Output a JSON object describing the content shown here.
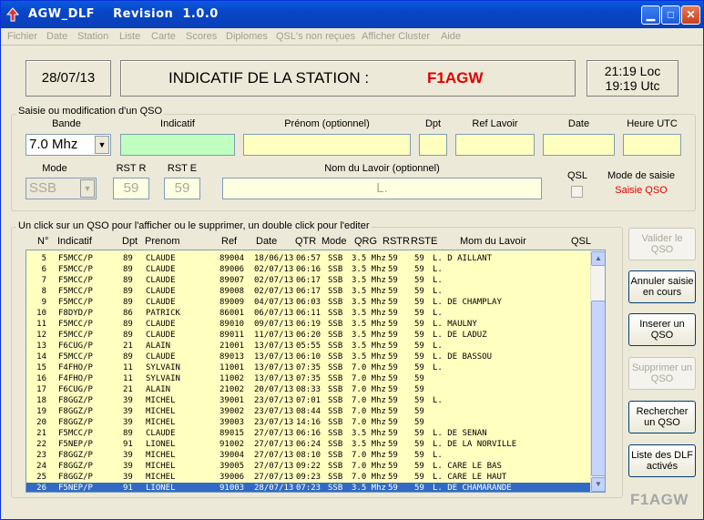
{
  "window": {
    "title": "AGW_DLF    Revision  1.0.0",
    "controls": [
      "minimize",
      "maximize",
      "close"
    ]
  },
  "menu": [
    "Fichier",
    "Date",
    "Station",
    "Liste",
    "Carte",
    "Scores",
    "Diplomes",
    "QSL's non reçues",
    "Afficher Cluster",
    "Aide"
  ],
  "header": {
    "date": "28/07/13",
    "station_label": "INDICATIF DE LA STATION  :",
    "callsign": "F1AGW",
    "time_loc": "21:19 Loc",
    "time_utc": "19:19 Utc"
  },
  "form": {
    "group_label": "Saisie ou modification d'un QSO",
    "labels": {
      "bande": "Bande",
      "indicatif": "Indicatif",
      "prenom": "Prénom (optionnel)",
      "dpt": "Dpt",
      "ref": "Ref Lavoir",
      "date": "Date",
      "heure": "Heure UTC",
      "mode": "Mode",
      "rstr": "RST R",
      "rste": "RST E",
      "lavoir": "Nom du Lavoir (optionnel)",
      "qsl": "QSL",
      "mode_saisie": "Mode de saisie"
    },
    "values": {
      "bande": "7.0 Mhz",
      "mode": "SSB",
      "rstr": "59",
      "rste": "59",
      "lavoir": "L.",
      "mode_saisie": "Saisie QSO"
    }
  },
  "list": {
    "hint": "Un click sur un QSO pour l'afficher ou le supprimer, un double click pour l'editer",
    "columns": [
      "N°",
      "Indicatif",
      "Dpt",
      "Prenom",
      "Ref",
      "Date",
      "QTR",
      "Mode",
      "QRG",
      "RSTR",
      "RSTE",
      "Mom du Lavoir",
      "QSL"
    ],
    "rows": [
      [
        "5",
        "F5MCC/P",
        "89",
        "CLAUDE",
        "89004",
        "18/06/13",
        "06:57",
        "SSB",
        "3.5 Mhz",
        "59",
        "59",
        "L. D AILLANT"
      ],
      [
        "6",
        "F5MCC/P",
        "89",
        "CLAUDE",
        "89006",
        "02/07/13",
        "06:16",
        "SSB",
        "3.5 Mhz",
        "59",
        "59",
        "L."
      ],
      [
        "7",
        "F5MCC/P",
        "89",
        "CLAUDE",
        "89007",
        "02/07/13",
        "06:17",
        "SSB",
        "3.5 Mhz",
        "59",
        "59",
        "L."
      ],
      [
        "8",
        "F5MCC/P",
        "89",
        "CLAUDE",
        "89008",
        "02/07/13",
        "06:17",
        "SSB",
        "3.5 Mhz",
        "59",
        "59",
        "L."
      ],
      [
        "9",
        "F5MCC/P",
        "89",
        "CLAUDE",
        "89009",
        "04/07/13",
        "06:03",
        "SSB",
        "3.5 Mhz",
        "59",
        "59",
        "L. DE CHAMPLAY"
      ],
      [
        "10",
        "F8DYD/P",
        "86",
        "PATRICK",
        "86001",
        "06/07/13",
        "06:11",
        "SSB",
        "3.5 Mhz",
        "59",
        "59",
        "L."
      ],
      [
        "11",
        "F5MCC/P",
        "89",
        "CLAUDE",
        "89010",
        "09/07/13",
        "06:19",
        "SSB",
        "3.5 Mhz",
        "59",
        "59",
        "L. MAULNY"
      ],
      [
        "12",
        "F5MCC/P",
        "89",
        "CLAUDE",
        "89011",
        "11/07/13",
        "06:20",
        "SSB",
        "3.5 Mhz",
        "59",
        "59",
        "L. DE LADUZ"
      ],
      [
        "13",
        "F6CUG/P",
        "21",
        "ALAIN",
        "21001",
        "13/07/13",
        "05:55",
        "SSB",
        "3.5 Mhz",
        "59",
        "59",
        "L."
      ],
      [
        "14",
        "F5MCC/P",
        "89",
        "CLAUDE",
        "89013",
        "13/07/13",
        "06:10",
        "SSB",
        "3.5 Mhz",
        "59",
        "59",
        "L. DE BASSOU"
      ],
      [
        "15",
        "F4FHO/P",
        "11",
        "SYLVAIN",
        "11001",
        "13/07/13",
        "07:35",
        "SSB",
        "7.0 Mhz",
        "59",
        "59",
        "L."
      ],
      [
        "16",
        "F4FHO/P",
        "11",
        "SYLVAIN",
        "11002",
        "13/07/13",
        "07:35",
        "SSB",
        "7.0 Mhz",
        "59",
        "59",
        ""
      ],
      [
        "17",
        "F6CUG/P",
        "21",
        "ALAIN",
        "21002",
        "20/07/13",
        "08:33",
        "SSB",
        "7.0 Mhz",
        "59",
        "59",
        ""
      ],
      [
        "18",
        "F8GGZ/P",
        "39",
        "MICHEL",
        "39001",
        "23/07/13",
        "07:01",
        "SSB",
        "7.0 Mhz",
        "59",
        "59",
        "L."
      ],
      [
        "19",
        "F8GGZ/P",
        "39",
        "MICHEL",
        "39002",
        "23/07/13",
        "08:44",
        "SSB",
        "7.0 Mhz",
        "59",
        "59",
        ""
      ],
      [
        "20",
        "F8GGZ/P",
        "39",
        "MICHEL",
        "39003",
        "23/07/13",
        "14:16",
        "SSB",
        "7.0 Mhz",
        "59",
        "59",
        ""
      ],
      [
        "21",
        "F5MCC/P",
        "89",
        "CLAUDE",
        "89015",
        "27/07/13",
        "06:16",
        "SSB",
        "3.5 Mhz",
        "59",
        "59",
        "L. DE SENAN"
      ],
      [
        "22",
        "F5NEP/P",
        "91",
        "LIONEL",
        "91002",
        "27/07/13",
        "06:24",
        "SSB",
        "3.5 Mhz",
        "59",
        "59",
        "L. DE LA NORVILLE"
      ],
      [
        "23",
        "F8GGZ/P",
        "39",
        "MICHEL",
        "39004",
        "27/07/13",
        "08:10",
        "SSB",
        "7.0 Mhz",
        "59",
        "59",
        "L."
      ],
      [
        "24",
        "F8GGZ/P",
        "39",
        "MICHEL",
        "39005",
        "27/07/13",
        "09:22",
        "SSB",
        "7.0 Mhz",
        "59",
        "59",
        "L. CARE LE BAS"
      ],
      [
        "25",
        "F8GGZ/P",
        "39",
        "MICHEL",
        "39006",
        "27/07/13",
        "09:23",
        "SSB",
        "7.0 Mhz",
        "59",
        "59",
        "L. CARE LE HAUT"
      ],
      [
        "26",
        "F5NEP/P",
        "91",
        "LIONEL",
        "91003",
        "28/07/13",
        "07:23",
        "SSB",
        "3.5 Mhz",
        "59",
        "59",
        "L. DE CHAMARANDE"
      ]
    ],
    "selected_row": 21
  },
  "buttons": [
    "Valider le QSO",
    "Annuler saisie en cours",
    "Inserer un QSO",
    "Supprimer un QSO",
    "Rechercher un QSO",
    "Liste des DLF activés"
  ],
  "brand": "F1AGW"
}
